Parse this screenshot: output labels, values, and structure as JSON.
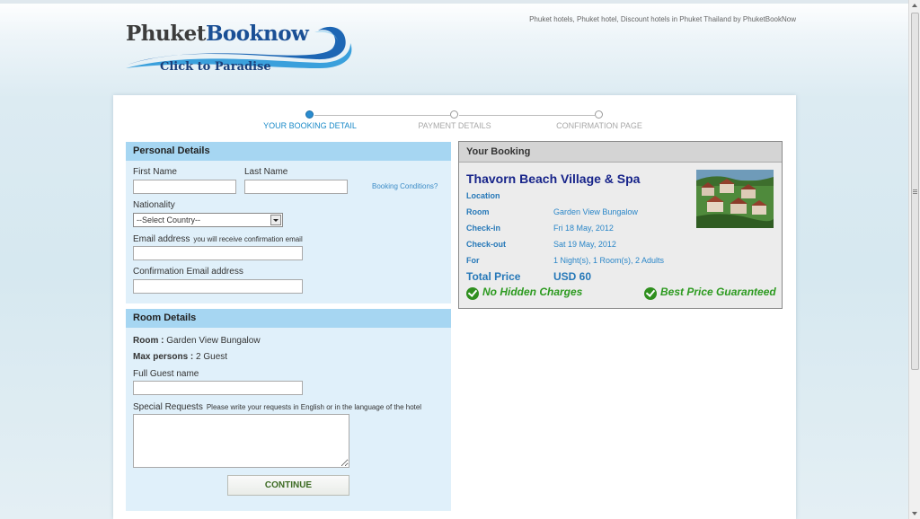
{
  "header": {
    "logo_part1": "Phuket",
    "logo_part2": "Booknow",
    "logo_tagline": "Click to Paradise",
    "seo_tagline": "Phuket hotels, Phuket hotel, Discount hotels in Phuket Thailand by PhuketBookNow"
  },
  "steps": [
    {
      "label": "YOUR BOOKING DETAIL",
      "active": true
    },
    {
      "label": "PAYMENT DETAILS",
      "active": false
    },
    {
      "label": "CONFIRMATION PAGE",
      "active": false
    }
  ],
  "personal": {
    "title": "Personal Details",
    "first_name_label": "First Name",
    "last_name_label": "Last Name",
    "booking_conditions_link": "Booking Conditions?",
    "nationality_label": "Nationality",
    "nationality_value": "--Select Country--",
    "email_label": "Email address",
    "email_hint": "you will receive confirmation email",
    "confirm_email_label": "Confirmation Email address",
    "first_name_value": "",
    "last_name_value": "",
    "email_value": "",
    "confirm_email_value": ""
  },
  "room": {
    "title": "Room Details",
    "room_label": "Room :",
    "room_value": "Garden View Bungalow",
    "max_persons_label": "Max persons :",
    "max_persons_value": "2 Guest",
    "guest_name_label": "Full Guest name",
    "guest_name_value": "",
    "special_requests_label": "Special Requests",
    "special_requests_hint": "Please write your requests in English or in the language of the hotel",
    "special_requests_value": "",
    "continue_label": "CONTINUE"
  },
  "booking": {
    "title": "Your Booking",
    "hotel_name": "Thavorn Beach Village & Spa",
    "location_label": "Location",
    "room_label": "Room",
    "room_value": "Garden View Bungalow",
    "checkin_label": "Check-in",
    "checkin_value": "Fri 18 May, 2012",
    "checkout_label": "Check-out",
    "checkout_value": "Sat 19 May, 2012",
    "for_label": "For",
    "for_value": "1 Night(s), 1 Room(s), 2 Adults",
    "total_label": "Total Price",
    "total_value": "USD 60",
    "badge_left": "No Hidden Charges",
    "badge_right": "Best Price Guaranteed"
  },
  "colors": {
    "accent_blue": "#2678b8",
    "hotel_name": "#17248a",
    "badge_green": "#2c9a1f",
    "panel_header": "#a6d6f2",
    "panel_body": "#e0f0fa"
  }
}
